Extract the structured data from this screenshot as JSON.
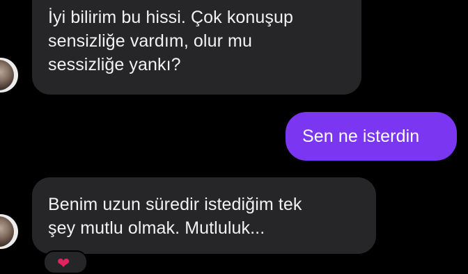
{
  "conversation": {
    "messages": [
      {
        "direction": "incoming",
        "lines": [
          "İyi bilirim bu hissi. Çok konuşup",
          "sensizliğe vardım, olur mu",
          "sessizliğe yankı?"
        ]
      },
      {
        "direction": "outgoing",
        "lines": [
          "Sen ne isterdin"
        ]
      },
      {
        "direction": "incoming",
        "lines": [
          "Benim uzun süredir istediğim tek",
          "şey mutlu olmak. Mutluluk..."
        ]
      }
    ],
    "reaction": {
      "icon": "heart-icon",
      "glyph": "❤"
    }
  },
  "colors": {
    "background": "#000000",
    "incoming_bubble": "#262629",
    "outgoing_bubble": "#7b36f2",
    "text": "#f2f2f2",
    "heart": "#e0245e"
  }
}
